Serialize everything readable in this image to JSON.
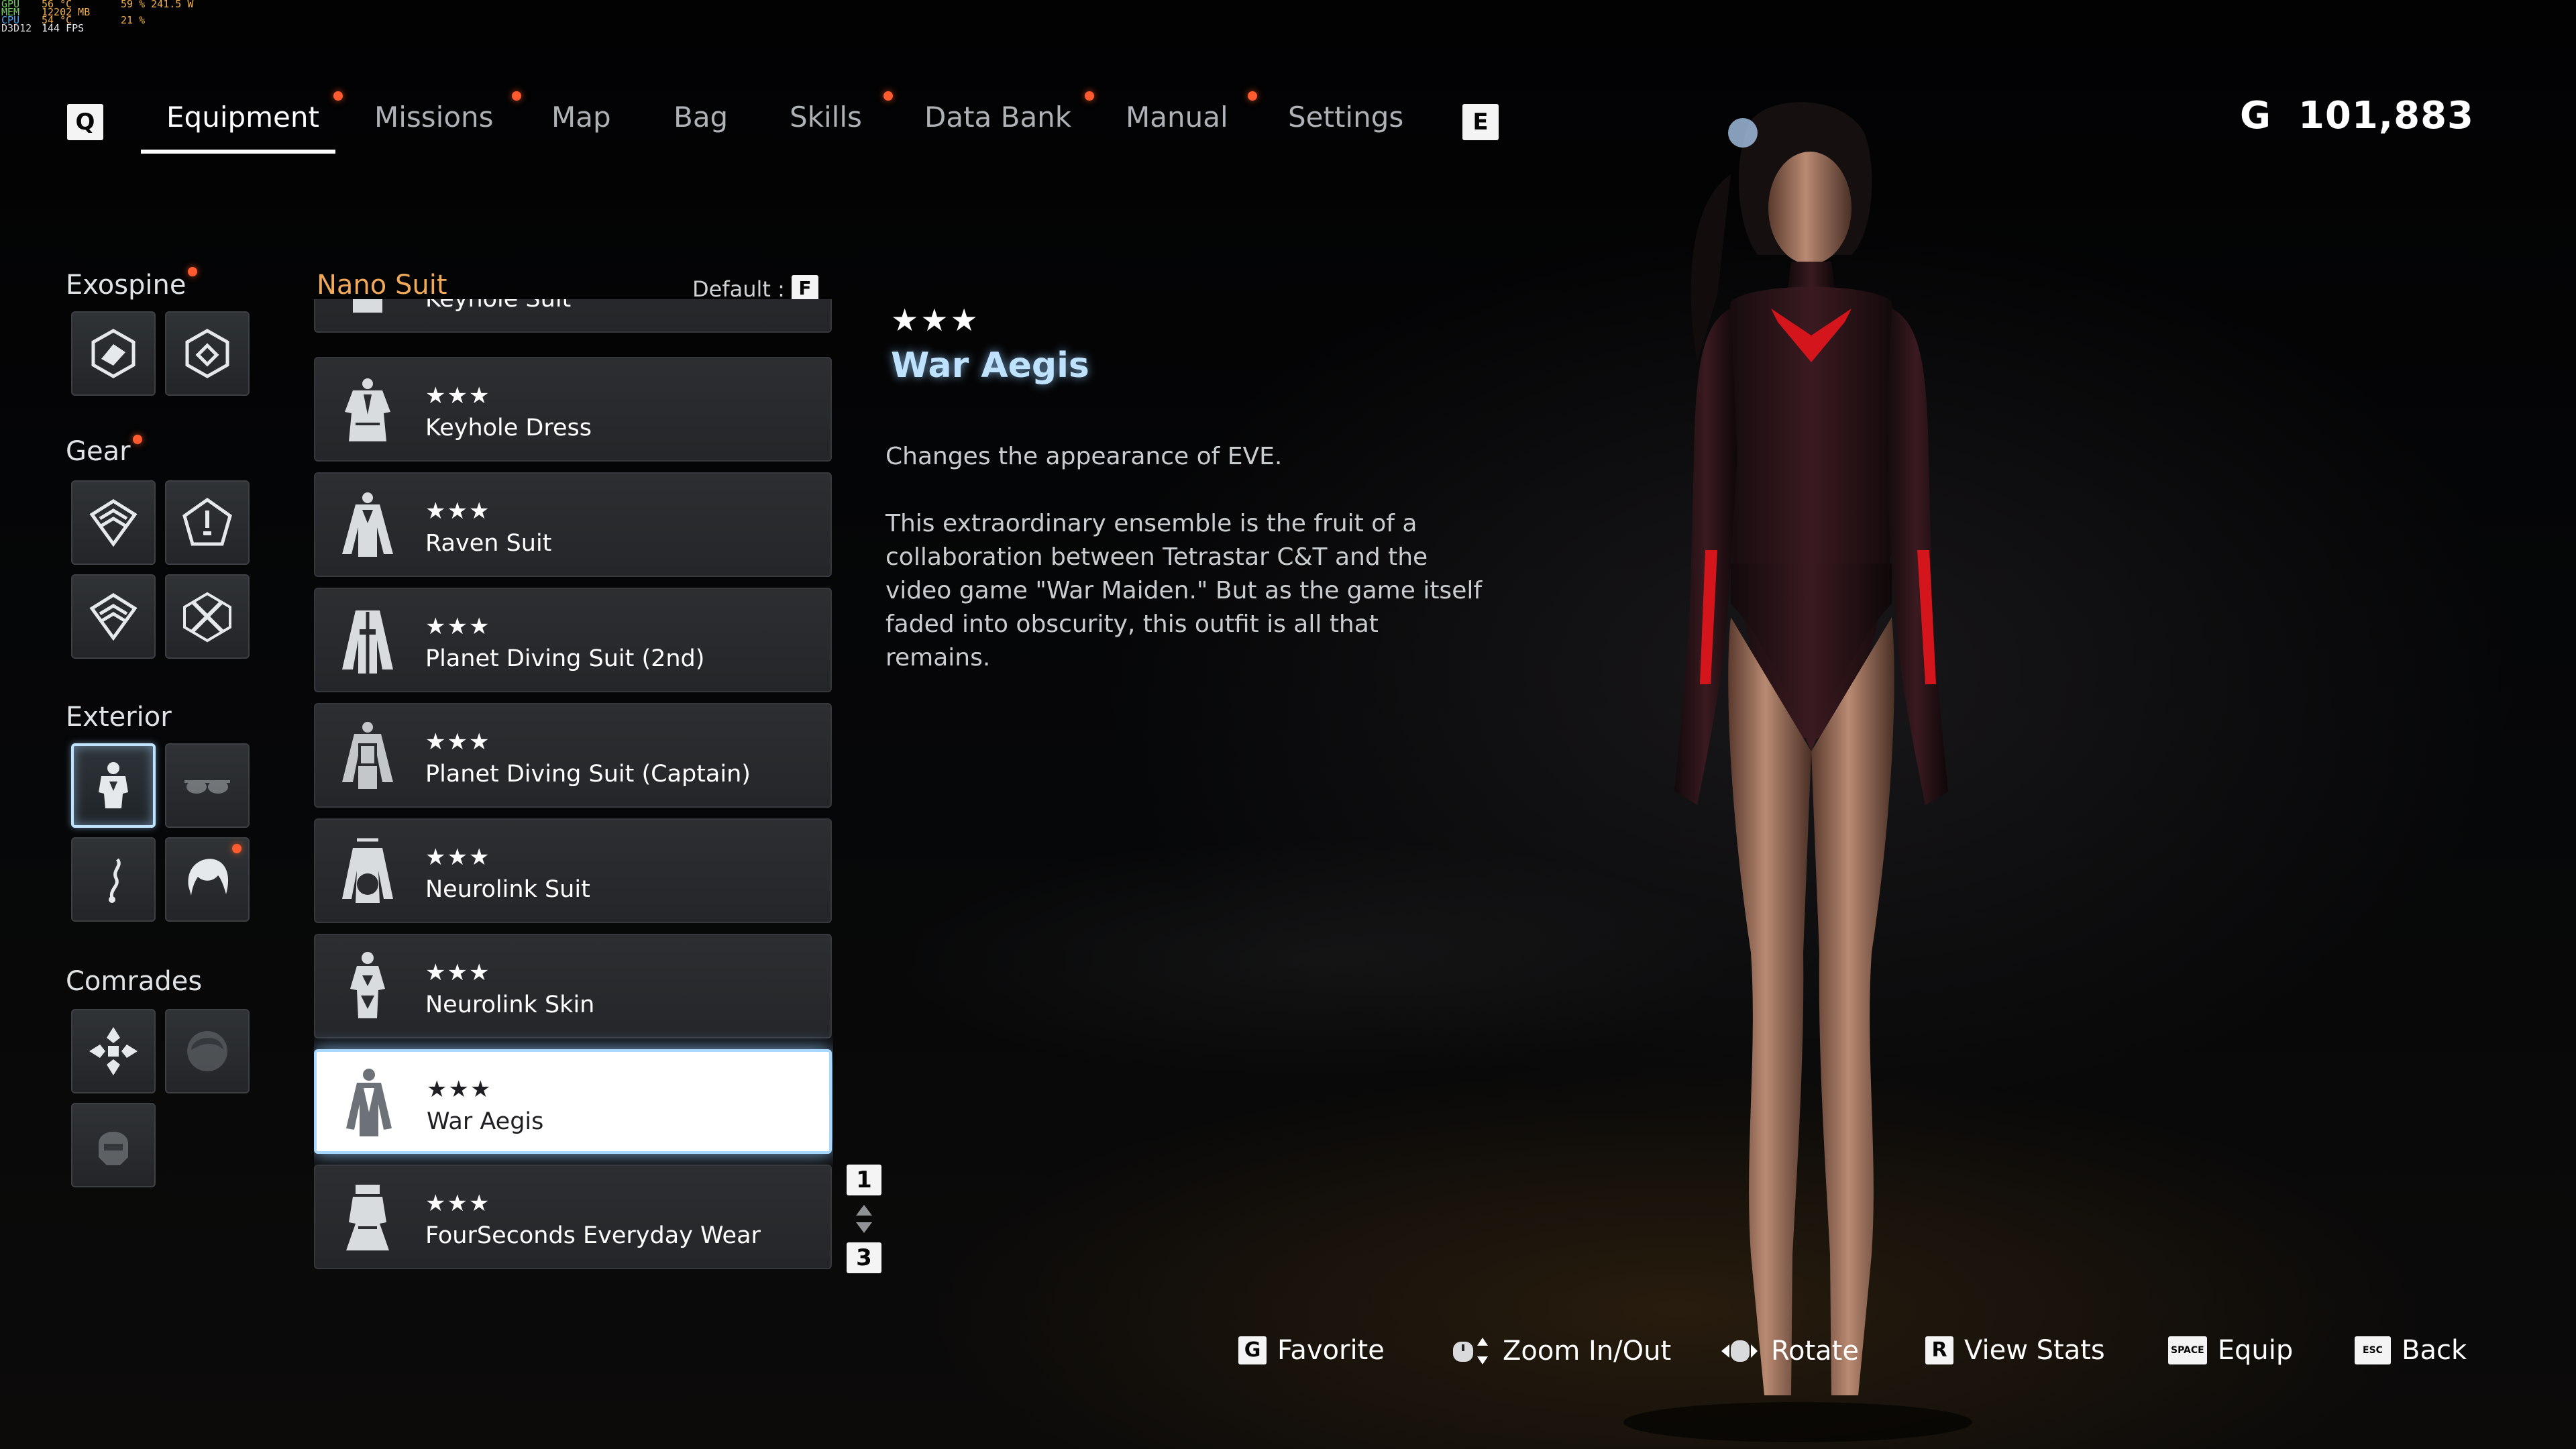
{
  "perf": {
    "rows": [
      {
        "k": "GPU",
        "a": "56 °C",
        "b": "59 % 241.5 W"
      },
      {
        "k": "MEM",
        "a": "12202 MB",
        "b": ""
      },
      {
        "k": "CPU",
        "a": "54 °C",
        "b": "21 %"
      },
      {
        "k": "D3D12",
        "a": "144 FPS",
        "b": ""
      }
    ]
  },
  "nav": {
    "left_key": "Q",
    "right_key": "E",
    "tabs": [
      {
        "label": "Equipment",
        "active": true,
        "dot": true
      },
      {
        "label": "Missions",
        "active": false,
        "dot": true
      },
      {
        "label": "Map",
        "active": false,
        "dot": false
      },
      {
        "label": "Bag",
        "active": false,
        "dot": false
      },
      {
        "label": "Skills",
        "active": false,
        "dot": true
      },
      {
        "label": "Data Bank",
        "active": false,
        "dot": true
      },
      {
        "label": "Manual",
        "active": false,
        "dot": true
      },
      {
        "label": "Settings",
        "active": false,
        "dot": false
      }
    ]
  },
  "currency": {
    "symbol": "G",
    "amount": "101,883"
  },
  "categories": {
    "exospine": "Exospine",
    "gear": "Gear",
    "exterior": "Exterior",
    "comrades": "Comrades"
  },
  "list": {
    "title": "Nano Suit",
    "sort_label": "Default :",
    "sort_key": "F",
    "items": [
      {
        "stars": "★★★",
        "name": "Keyhole Suit",
        "selected": false
      },
      {
        "stars": "★★★",
        "name": "Keyhole Dress",
        "selected": false
      },
      {
        "stars": "★★★",
        "name": "Raven Suit",
        "selected": false
      },
      {
        "stars": "★★★",
        "name": "Planet Diving Suit (2nd)",
        "selected": false
      },
      {
        "stars": "★★★",
        "name": "Planet Diving Suit (Captain)",
        "selected": false
      },
      {
        "stars": "★★★",
        "name": "Neurolink Suit",
        "selected": false
      },
      {
        "stars": "★★★",
        "name": "Neurolink Skin",
        "selected": false
      },
      {
        "stars": "★★★",
        "name": "War Aegis",
        "selected": true
      },
      {
        "stars": "★★★",
        "name": "FourSeconds Everyday Wear",
        "selected": false
      }
    ],
    "page_up_key": "1",
    "page_down_key": "3"
  },
  "detail": {
    "stars": "★★★",
    "title": "War Aegis",
    "summary": "Changes the appearance of EVE.",
    "description_lines": [
      "This extraordinary ensemble is the fruit of a",
      "collaboration between Tetrastar C&T and the",
      "video game \"War Maiden.\" But as the game itself",
      "faded into obscurity, this outfit is all that",
      "remains."
    ]
  },
  "hints": {
    "favorite": {
      "key": "G",
      "label": "Favorite"
    },
    "zoom": {
      "label": "Zoom In/Out"
    },
    "rotate": {
      "label": "Rotate"
    },
    "view_stats": {
      "key": "R",
      "label": "View Stats"
    },
    "equip": {
      "key": "SPACE",
      "label": "Equip"
    },
    "back": {
      "key": "ESC",
      "label": "Back"
    }
  },
  "colors": {
    "accent_blue": "#bfe3ff",
    "list_title": "#f0a95a",
    "notification_dot": "#ff5b2e",
    "suit_red": "#d4161c"
  }
}
